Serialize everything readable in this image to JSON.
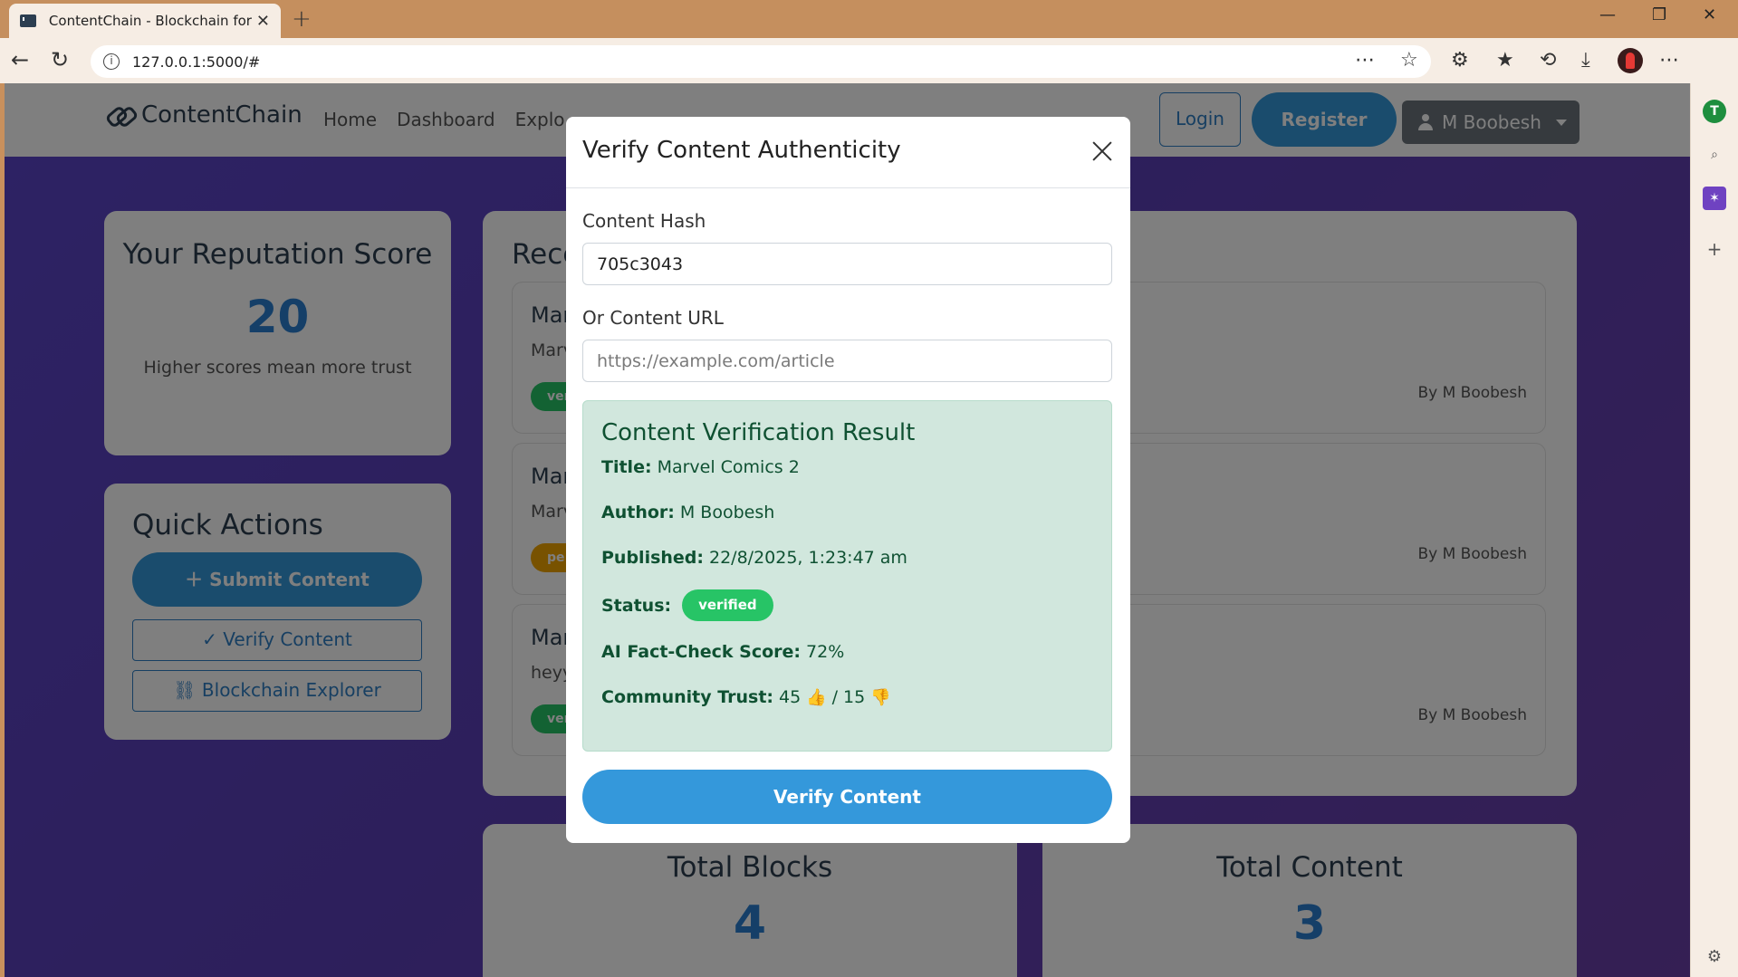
{
  "browser": {
    "tab_title": "ContentChain - Blockchain for Co",
    "new_tab_icon": "+",
    "url": "127.0.0.1:5000/#",
    "minimize": "—",
    "restore": "❐",
    "close": "✕"
  },
  "sidebar_strip": {
    "avatar_letter": "T"
  },
  "app": {
    "brand": "ContentChain",
    "nav": [
      "Home",
      "Dashboard",
      "Explo"
    ],
    "login": "Login",
    "register": "Register",
    "user": "M Boobesh"
  },
  "reputation": {
    "title": "Your Reputation Score",
    "score": "20",
    "subtitle": "Higher scores mean more trust"
  },
  "quick_actions": {
    "title": "Quick Actions",
    "submit": "Submit Content",
    "verify": "Verify Content",
    "explorer": "Blockchain Explorer"
  },
  "recent": {
    "title": "Rece",
    "items": [
      {
        "title": "Mar",
        "desc": "Marv",
        "badge": "ver",
        "badge_color": "#27c466",
        "author": "By M Boobesh"
      },
      {
        "title": "Mar",
        "desc": "Marv",
        "badge": "pe",
        "badge_color": "#f0a500",
        "author": "By M Boobesh"
      },
      {
        "title": "Mar",
        "desc": "heyy",
        "badge": "ver",
        "badge_color": "#27c466",
        "author": "By M Boobesh"
      }
    ]
  },
  "stats": {
    "blocks_label": "Total Blocks",
    "blocks_value": "4",
    "content_label": "Total Content",
    "content_value": "3"
  },
  "modal": {
    "title": "Verify Content Authenticity",
    "hash_label": "Content Hash",
    "hash_value": "705c3043",
    "url_label": "Or Content URL",
    "url_placeholder": "https://example.com/article",
    "result": {
      "heading": "Content Verification Result",
      "title_label": "Title:",
      "title_value": "Marvel Comics 2",
      "author_label": "Author:",
      "author_value": "M Boobesh",
      "published_label": "Published:",
      "published_value": "22/8/2025, 1:23:47 am",
      "status_label": "Status:",
      "status_value": "verified",
      "ai_label": "AI Fact-Check Score:",
      "ai_value": "72%",
      "trust_label": "Community Trust:",
      "trust_up": "45",
      "trust_down": "/ 15"
    },
    "verify_button": "Verify Content"
  },
  "colors": {
    "primary": "#3498db",
    "success": "#27c466",
    "result_bg": "#d1e7dd",
    "result_text": "#0f5132"
  }
}
